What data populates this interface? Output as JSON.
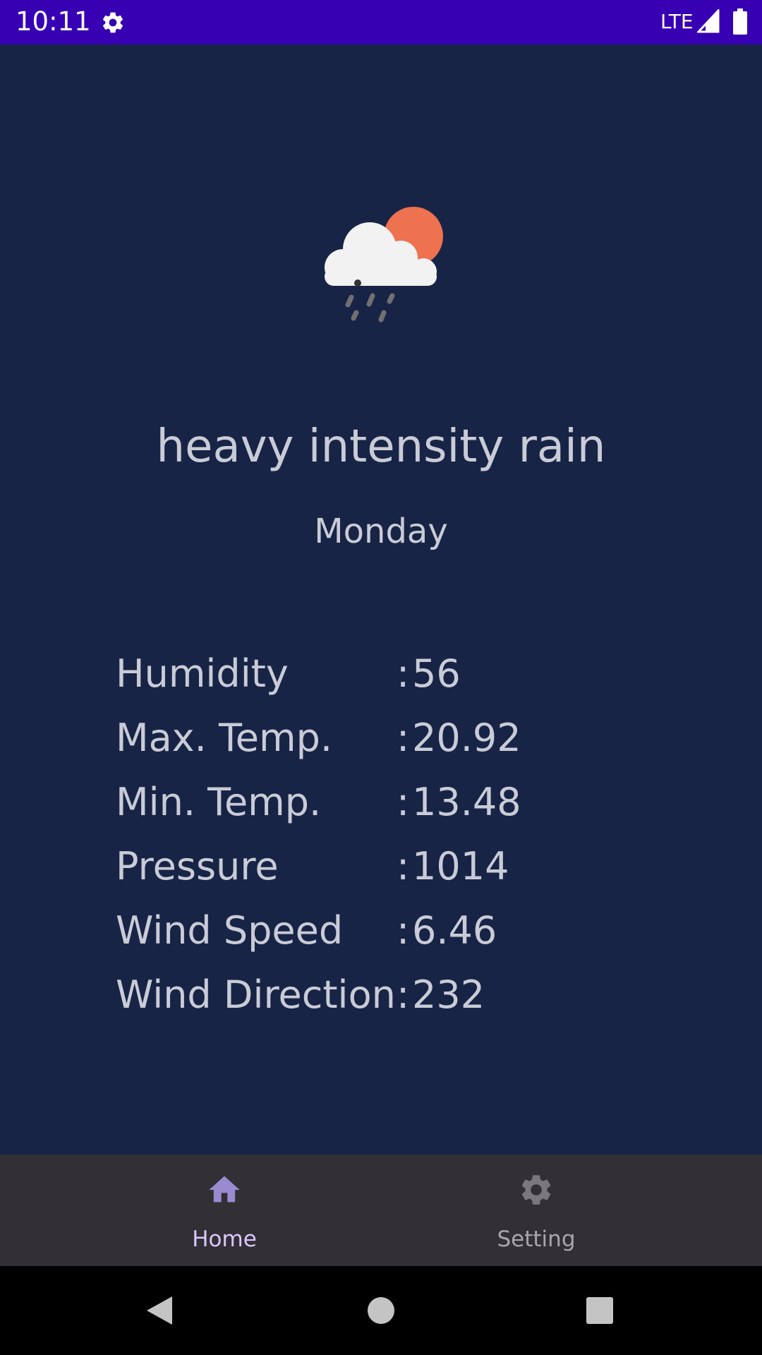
{
  "status_bar": {
    "time": "10:11",
    "network": "LTE",
    "icons": [
      "gear-icon",
      "signal-icon",
      "battery-icon"
    ]
  },
  "weather": {
    "icon": "cloud-sun-rain-icon",
    "condition": "heavy intensity rain",
    "day": "Monday"
  },
  "stats": [
    {
      "label": "Humidity",
      "colon": ":",
      "value": "56"
    },
    {
      "label": "Max. Temp.",
      "colon": ":",
      "value": "20.92"
    },
    {
      "label": "Min. Temp.",
      "colon": ":",
      "value": "13.48"
    },
    {
      "label": "Pressure",
      "colon": ":",
      "value": "1014"
    },
    {
      "label": "Wind Speed",
      "colon": ":",
      "value": "6.46"
    },
    {
      "label": "Wind Direction",
      "colon": ":",
      "value": "232"
    }
  ],
  "bottom_nav": {
    "items": [
      {
        "label": "Home",
        "icon": "home-icon",
        "selected": true
      },
      {
        "label": "Setting",
        "icon": "gear-icon",
        "selected": false
      }
    ]
  },
  "system_nav": {
    "buttons": [
      "back-icon",
      "home-circle-icon",
      "recents-icon"
    ]
  },
  "colors": {
    "status_bar": "#3700B3",
    "background": "#182446",
    "bottom_nav": "#322f35",
    "text": "#c9ccd6",
    "selected_nav": "#d8c8ff",
    "sun": "#ee7150"
  }
}
